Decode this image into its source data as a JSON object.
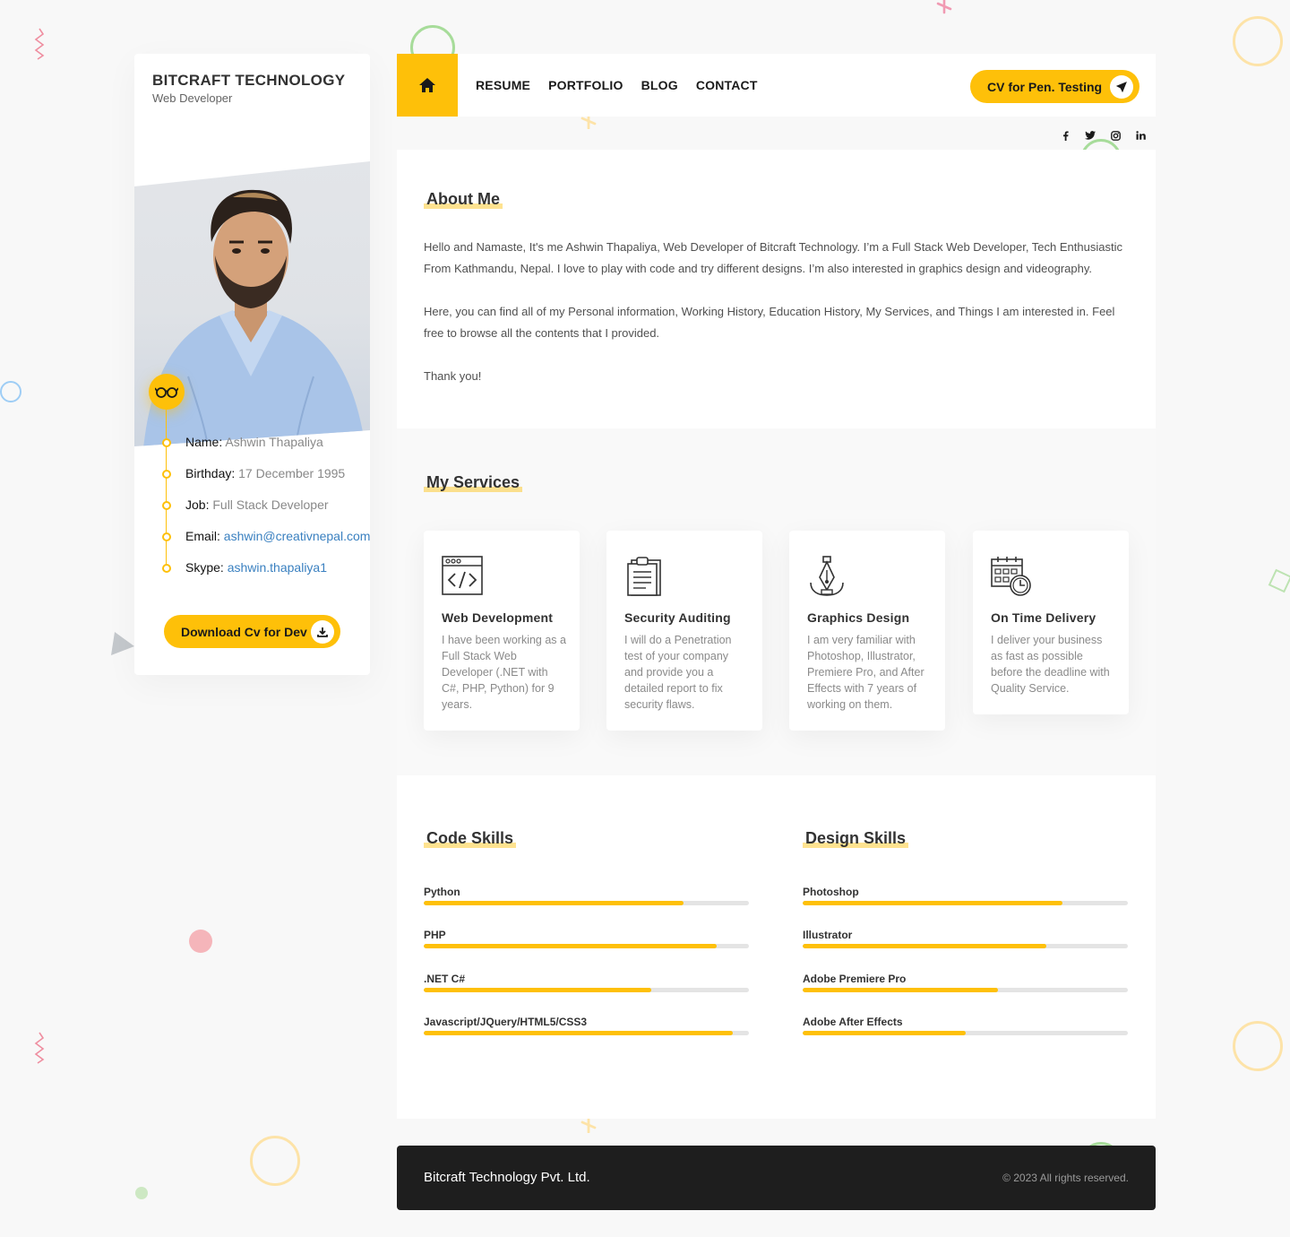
{
  "sidebar": {
    "brand_name": "BITCRAFT TECHNOLOGY",
    "brand_subtitle": "Web Developer",
    "badge_icon": "glasses-icon",
    "info": [
      {
        "key": "Name:",
        "value": "Ashwin Thapaliya"
      },
      {
        "key": "Birthday:",
        "value": "17 December 1995"
      },
      {
        "key": "Job:",
        "value": "Full Stack Developer"
      },
      {
        "key": "Email:",
        "value": "ashwin@creativnepal.com"
      },
      {
        "key": "Skype:",
        "value": "ashwin.thapaliya1"
      }
    ],
    "download_label": "Download Cv for Dev",
    "download_icon": "download-icon"
  },
  "header": {
    "home_icon": "home-icon",
    "nav": [
      "RESUME",
      "PORTFOLIO",
      "BLOG",
      "CONTACT"
    ],
    "cv_button": "CV for Pen. Testing",
    "cv_icon": "paper-plane-icon",
    "social": [
      "facebook-icon",
      "twitter-icon",
      "instagram-icon",
      "linkedin-icon"
    ]
  },
  "about": {
    "title": "About Me",
    "paragraphs": [
      "Hello and Namaste, It's me Ashwin Thapaliya, Web Developer of Bitcraft Technology. I’m a Full Stack Web Developer, Tech Enthusiastic From Kathmandu, Nepal. I love to play with code and try different designs. I’m also interested in graphics design and videography.",
      "Here, you can find all of my Personal information, Working History, Education History, My Services, and Things I am interested in. Feel free to browse all the contents that I provided.",
      "Thank you!"
    ]
  },
  "services": {
    "title": "My Services",
    "items": [
      {
        "icon": "web-code-icon",
        "title": "Web Development",
        "text": "I have been working as a Full Stack Web Developer (.NET with C#, PHP, Python) for 9 years."
      },
      {
        "icon": "clipboard-icon",
        "title": "Security Auditing",
        "text": "I will do a Penetration test of your company and provide you a detailed report to fix security flaws."
      },
      {
        "icon": "pen-tool-icon",
        "title": "Graphics Design",
        "text": "I am very familiar with Photoshop, Illustrator, Premiere Pro, and After Effects with 7 years of working on them."
      },
      {
        "icon": "calendar-clock-icon",
        "title": "On Time Delivery",
        "text": "I deliver your business as fast as possible before the deadline with Quality Service."
      }
    ]
  },
  "code_skills": {
    "title": "Code Skills",
    "items": [
      {
        "name": "Python",
        "level": 0.8
      },
      {
        "name": "PHP",
        "level": 0.9
      },
      {
        "name": ".NET C#",
        "level": 0.7
      },
      {
        "name": "Javascript/JQuery/HTML5/CSS3",
        "level": 0.95
      }
    ]
  },
  "design_skills": {
    "title": "Design Skills",
    "items": [
      {
        "name": "Photoshop",
        "level": 0.8
      },
      {
        "name": "Illustrator",
        "level": 0.75
      },
      {
        "name": "Adobe Premiere Pro",
        "level": 0.6
      },
      {
        "name": "Adobe After Effects",
        "level": 0.5
      }
    ]
  },
  "footer": {
    "company": "Bitcraft Technology Pvt. Ltd.",
    "copyright": "© 2023 All rights reserved."
  },
  "colors": {
    "accent": "#fec009",
    "footer_bg": "#1e1e1e",
    "link": "#3a80c0"
  }
}
